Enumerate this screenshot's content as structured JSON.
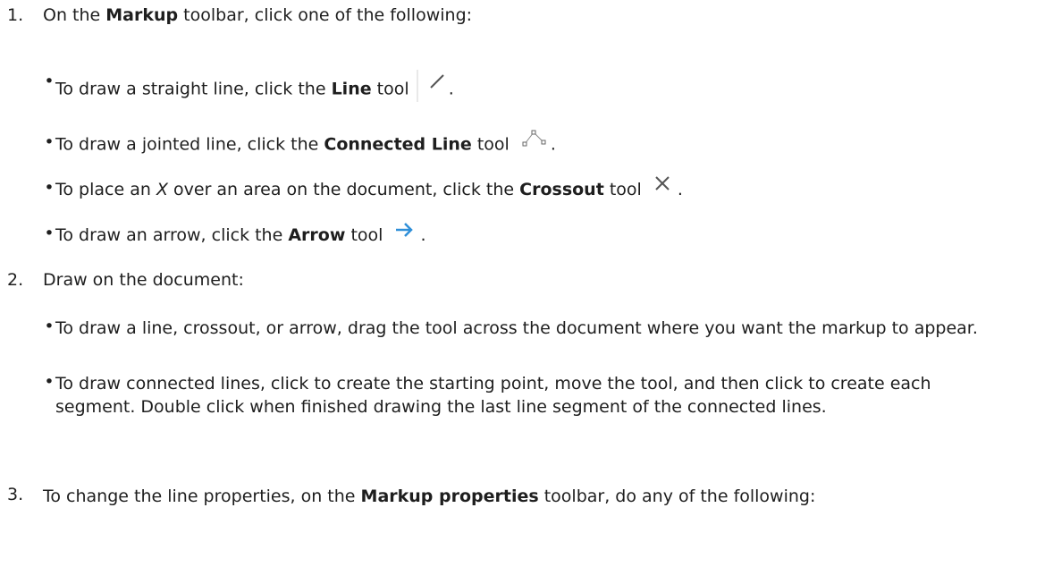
{
  "step1": {
    "number": "1.",
    "pre": "On the ",
    "bold": "Markup",
    "post": " toolbar, click one of the following:",
    "bullets": [
      {
        "pre": "To draw a straight line, click the ",
        "bold": "Line",
        "post": " tool",
        "end": ".",
        "icon": "line-tool-icon"
      },
      {
        "pre": "To draw a jointed line, click the ",
        "bold": "Connected Line",
        "post": " tool",
        "end": ".",
        "icon": "connected-line-tool-icon"
      },
      {
        "pre": "To place an ",
        "italic": "X",
        "mid": " over an area on the document, click the ",
        "bold": "Crossout",
        "post": " tool",
        "end": ".",
        "icon": "crossout-tool-icon"
      },
      {
        "pre": "To draw an arrow, click the ",
        "bold": "Arrow",
        "post": " tool",
        "end": ".",
        "icon": "arrow-tool-icon"
      }
    ]
  },
  "step2": {
    "number": "2.",
    "text": "Draw on the document:",
    "bullets": [
      {
        "text": "To draw a line, crossout, or arrow, drag the tool across the document where you want the markup to appear."
      },
      {
        "text": "To draw connected lines, click to create the starting point, move the tool, and then click to create each segment.  Double click when finished drawing the last line segment of the connected lines."
      }
    ]
  },
  "step3": {
    "number": "3.",
    "pre": "To change the line properties, on the ",
    "bold": "Markup properties",
    "post": " toolbar, do any of the following:"
  },
  "colors": {
    "text": "#1e1e1e",
    "arrow_icon": "#2f8fd8",
    "icon_gray": "#666666"
  }
}
